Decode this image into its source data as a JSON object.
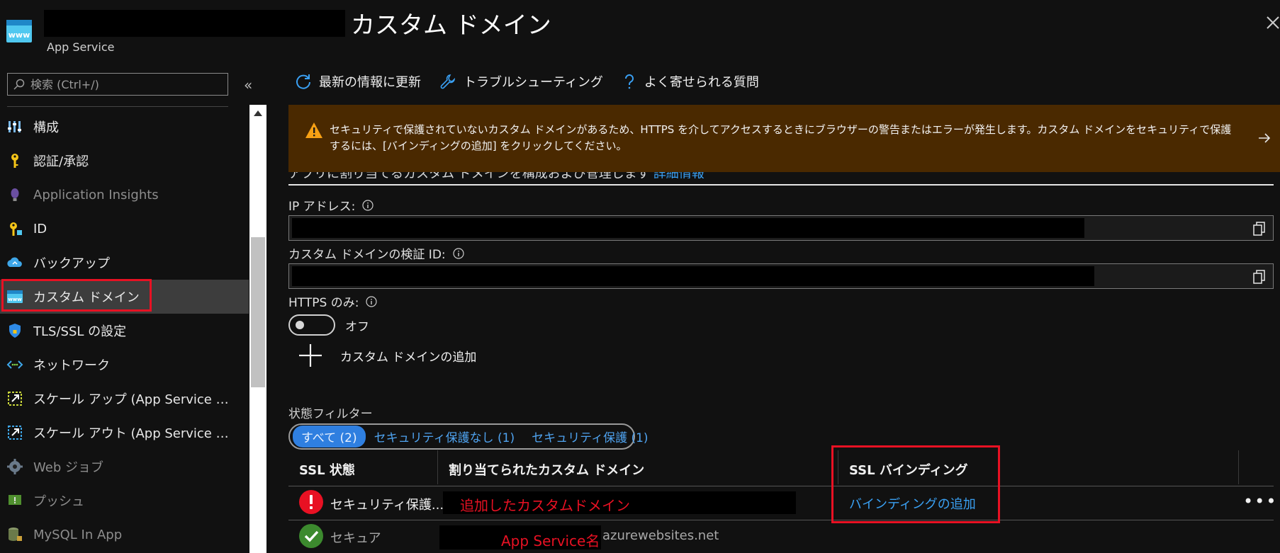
{
  "header": {
    "title": "カスタム ドメイン",
    "subtitle": "App Service"
  },
  "sidebar": {
    "search_placeholder": "検索 (Ctrl+/)",
    "collapse_glyph": "«",
    "items": [
      {
        "label": "構成",
        "icon": "settings-bars-icon"
      },
      {
        "label": "認証/承認",
        "icon": "key-icon"
      },
      {
        "label": "Application Insights",
        "icon": "lightbulb-icon",
        "dim": true
      },
      {
        "label": "ID",
        "icon": "identity-key-icon"
      },
      {
        "label": "バックアップ",
        "icon": "cloud-backup-icon"
      },
      {
        "label": "カスタム ドメイン",
        "icon": "www-icon",
        "selected": true
      },
      {
        "label": "TLS/SSL の設定",
        "icon": "shield-icon"
      },
      {
        "label": "ネットワーク",
        "icon": "network-icon"
      },
      {
        "label": "スケール アップ (App Service のプ...",
        "icon": "scale-up-icon"
      },
      {
        "label": "スケール アウト (App Service のプ...",
        "icon": "scale-out-icon"
      },
      {
        "label": "Web ジョブ",
        "icon": "gear-icon",
        "dim": true
      },
      {
        "label": "プッシュ",
        "icon": "push-icon",
        "dim": true
      },
      {
        "label": "MySQL In App",
        "icon": "database-icon",
        "dim": true
      }
    ]
  },
  "toolbar": {
    "refresh_label": "最新の情報に更新",
    "troubleshoot_label": "トラブルシューティング",
    "faq_label": "よく寄せられる質問"
  },
  "banner": {
    "text": "セキュリティで保護されていないカスタム ドメインがあるため、HTTPS を介してアクセスするときにブラウザーの警告またはエラーが発生します。カスタム ドメインをセキュリティで保護するには、[バインディングの追加] をクリックしてください。",
    "partial_text": "アプリに割り当てるカスタム ドメインを構成および管理します",
    "partial_link": "詳細情報"
  },
  "fields": {
    "ip_label": "IP アドレス:",
    "verification_label": "カスタム ドメインの検証 ID:",
    "https_label": "HTTPS のみ:",
    "https_state": "オフ",
    "https_enabled": false
  },
  "add_domain_label": "カスタム ドメインの追加",
  "filter": {
    "label": "状態フィルター",
    "options": [
      "すべて (2)",
      "セキュリティ保護なし (1)",
      "セキュリティ保護 (1)"
    ],
    "selected": "すべて (2)"
  },
  "table": {
    "headers": [
      "SSL 状態",
      "割り当てられたカスタム ドメイン",
      "SSL バインディング"
    ],
    "rows": [
      {
        "status": "セキュリティ保護...",
        "status_type": "error",
        "domain_annotation": "追加したカスタムドメイン",
        "binding": "バインディングの追加",
        "more": "•••"
      },
      {
        "status": "セキュア",
        "status_type": "ok",
        "domain_annotation": "App Service名",
        "domain_suffix": "azurewebsites.net"
      }
    ]
  },
  "colors": {
    "accent_blue": "#3aa0f3",
    "warning_banner": "#4a2900",
    "highlight_red": "#e81123",
    "ok_green": "#3c8a2e"
  }
}
